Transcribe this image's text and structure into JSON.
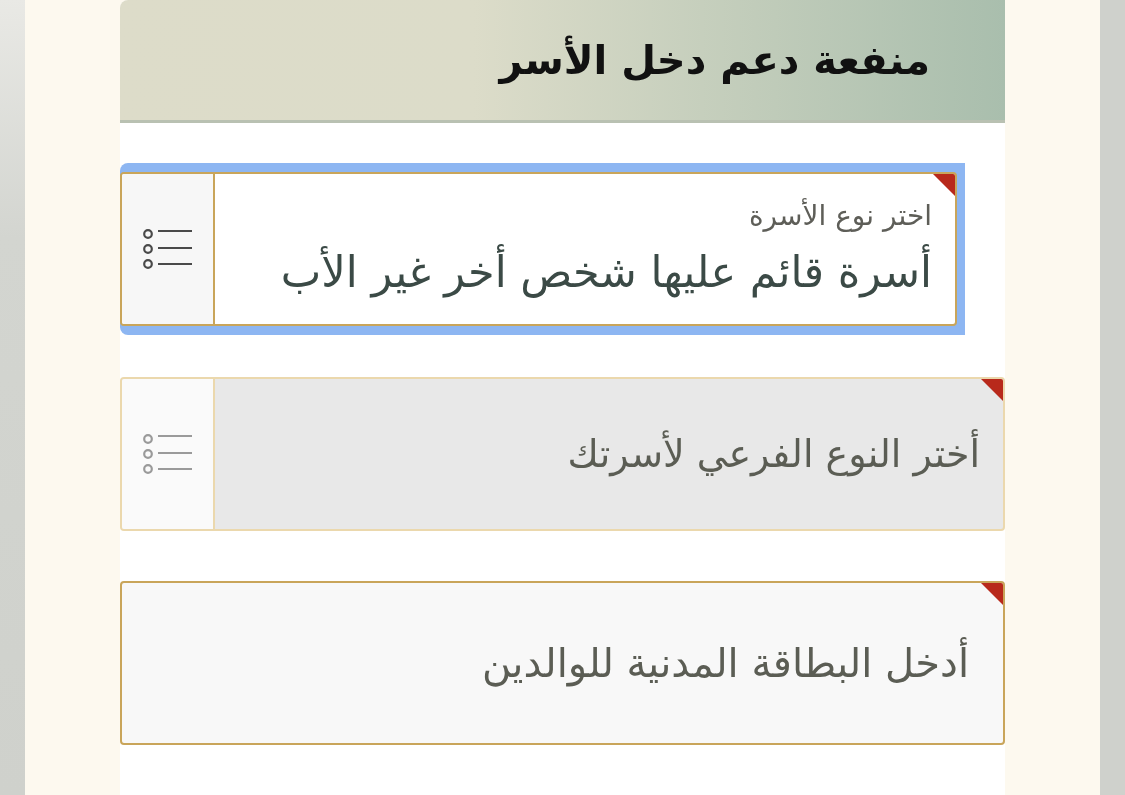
{
  "header": {
    "title": "منفعة دعم دخل الأسر"
  },
  "fields": [
    {
      "kind": "select",
      "label": "اختر نوع الأسرة",
      "value": "أسرة قائم عليها شخص أخر غير الأب",
      "focused": true,
      "disabled": false,
      "required": true
    },
    {
      "kind": "select",
      "placeholder": "أختر النوع الفرعي لأسرتك",
      "focused": false,
      "disabled": true,
      "required": true
    },
    {
      "kind": "text",
      "placeholder": "أدخل البطاقة المدنية للوالدين",
      "focused": false,
      "disabled": false,
      "required": true
    }
  ]
}
